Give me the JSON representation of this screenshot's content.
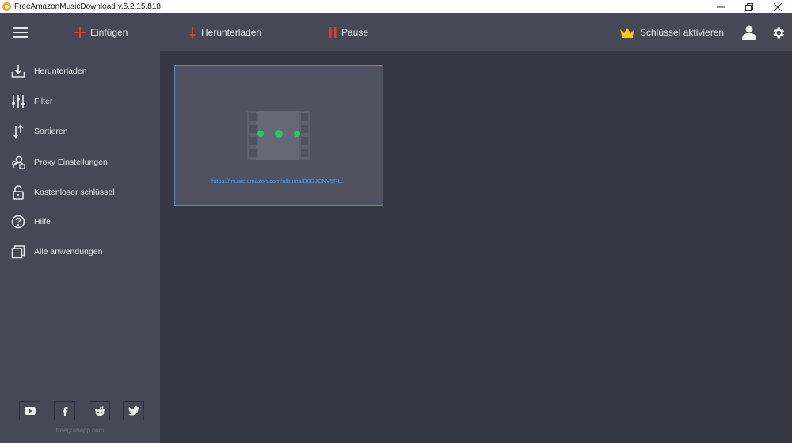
{
  "window": {
    "title": "FreeAmazonMusicDownload  v.5.2.15.818"
  },
  "toolbar": {
    "paste_label": "Einfügen",
    "download_label": "Herunterladen",
    "pause_label": "Pause",
    "activate_label": "Schlüssel aktivieren"
  },
  "sidebar": {
    "items": [
      {
        "label": "Herunterladen",
        "icon": "download-icon"
      },
      {
        "label": "Filter",
        "icon": "filter-sliders-icon"
      },
      {
        "label": "Sortieren",
        "icon": "sort-arrows-icon"
      },
      {
        "label": "Proxy Einstellungen",
        "icon": "proxy-icon"
      },
      {
        "label": "Kostenloser schlüssel",
        "icon": "unlock-icon"
      },
      {
        "label": "Hilfe",
        "icon": "help-icon"
      },
      {
        "label": "Alle anwendungen",
        "icon": "apps-icon"
      }
    ],
    "social": [
      "youtube-icon",
      "facebook-icon",
      "reddit-icon",
      "twitter-icon"
    ],
    "footer": "freegrabapp.com"
  },
  "main": {
    "card": {
      "url": "https://music.amazon.com/albums/B0DJCNV5RL..."
    }
  },
  "colors": {
    "accent_red": "#e53935",
    "crown_yellow": "#f5c518",
    "link_blue": "#4b9cf0",
    "loading_green": "#27c46b",
    "panel": "#464955",
    "content": "#353842"
  }
}
